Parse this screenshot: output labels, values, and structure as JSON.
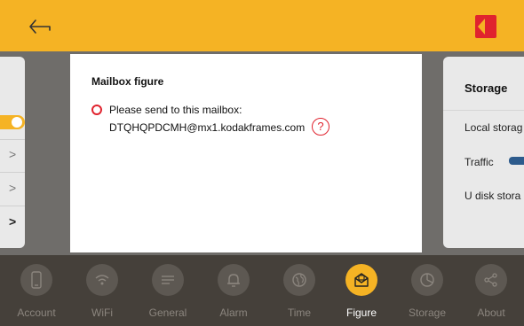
{
  "header": {
    "back_icon": "arrow-left-icon",
    "logo": {
      "text": "KODAK",
      "colors": {
        "background": "#e0232e",
        "mark": "#f5b324"
      }
    }
  },
  "left_panel": {
    "toggle_state": "on",
    "chevrons": [
      ">",
      ">",
      ">"
    ]
  },
  "right_panel": {
    "title": "Storage",
    "items": [
      "Local storag",
      "Traffic",
      "U disk stora"
    ],
    "traffic_toggle": "on"
  },
  "dialog": {
    "title": "Mailbox figure",
    "option_label": "Please send to this mailbox:",
    "email": "DTQHQPDCMH@mx1.kodakframes.com",
    "help_icon": "question-icon",
    "help_text": "?"
  },
  "nav": {
    "active": "Figure",
    "items": [
      {
        "label": "Account",
        "icon": "phone-icon"
      },
      {
        "label": "WiFi",
        "icon": "wifi-icon"
      },
      {
        "label": "General",
        "icon": "menu-icon"
      },
      {
        "label": "Alarm",
        "icon": "bell-icon"
      },
      {
        "label": "Time",
        "icon": "globe-icon"
      },
      {
        "label": "Figure",
        "icon": "mailbox-icon"
      },
      {
        "label": "Storage",
        "icon": "pie-chart-icon"
      },
      {
        "label": "About",
        "icon": "share-icon"
      }
    ]
  },
  "colors": {
    "accent": "#f5b324",
    "danger": "#e0232e",
    "nav_background": "#45403a",
    "overlay": "#6f6d6a",
    "toggle_blue": "#2d5b8c"
  }
}
